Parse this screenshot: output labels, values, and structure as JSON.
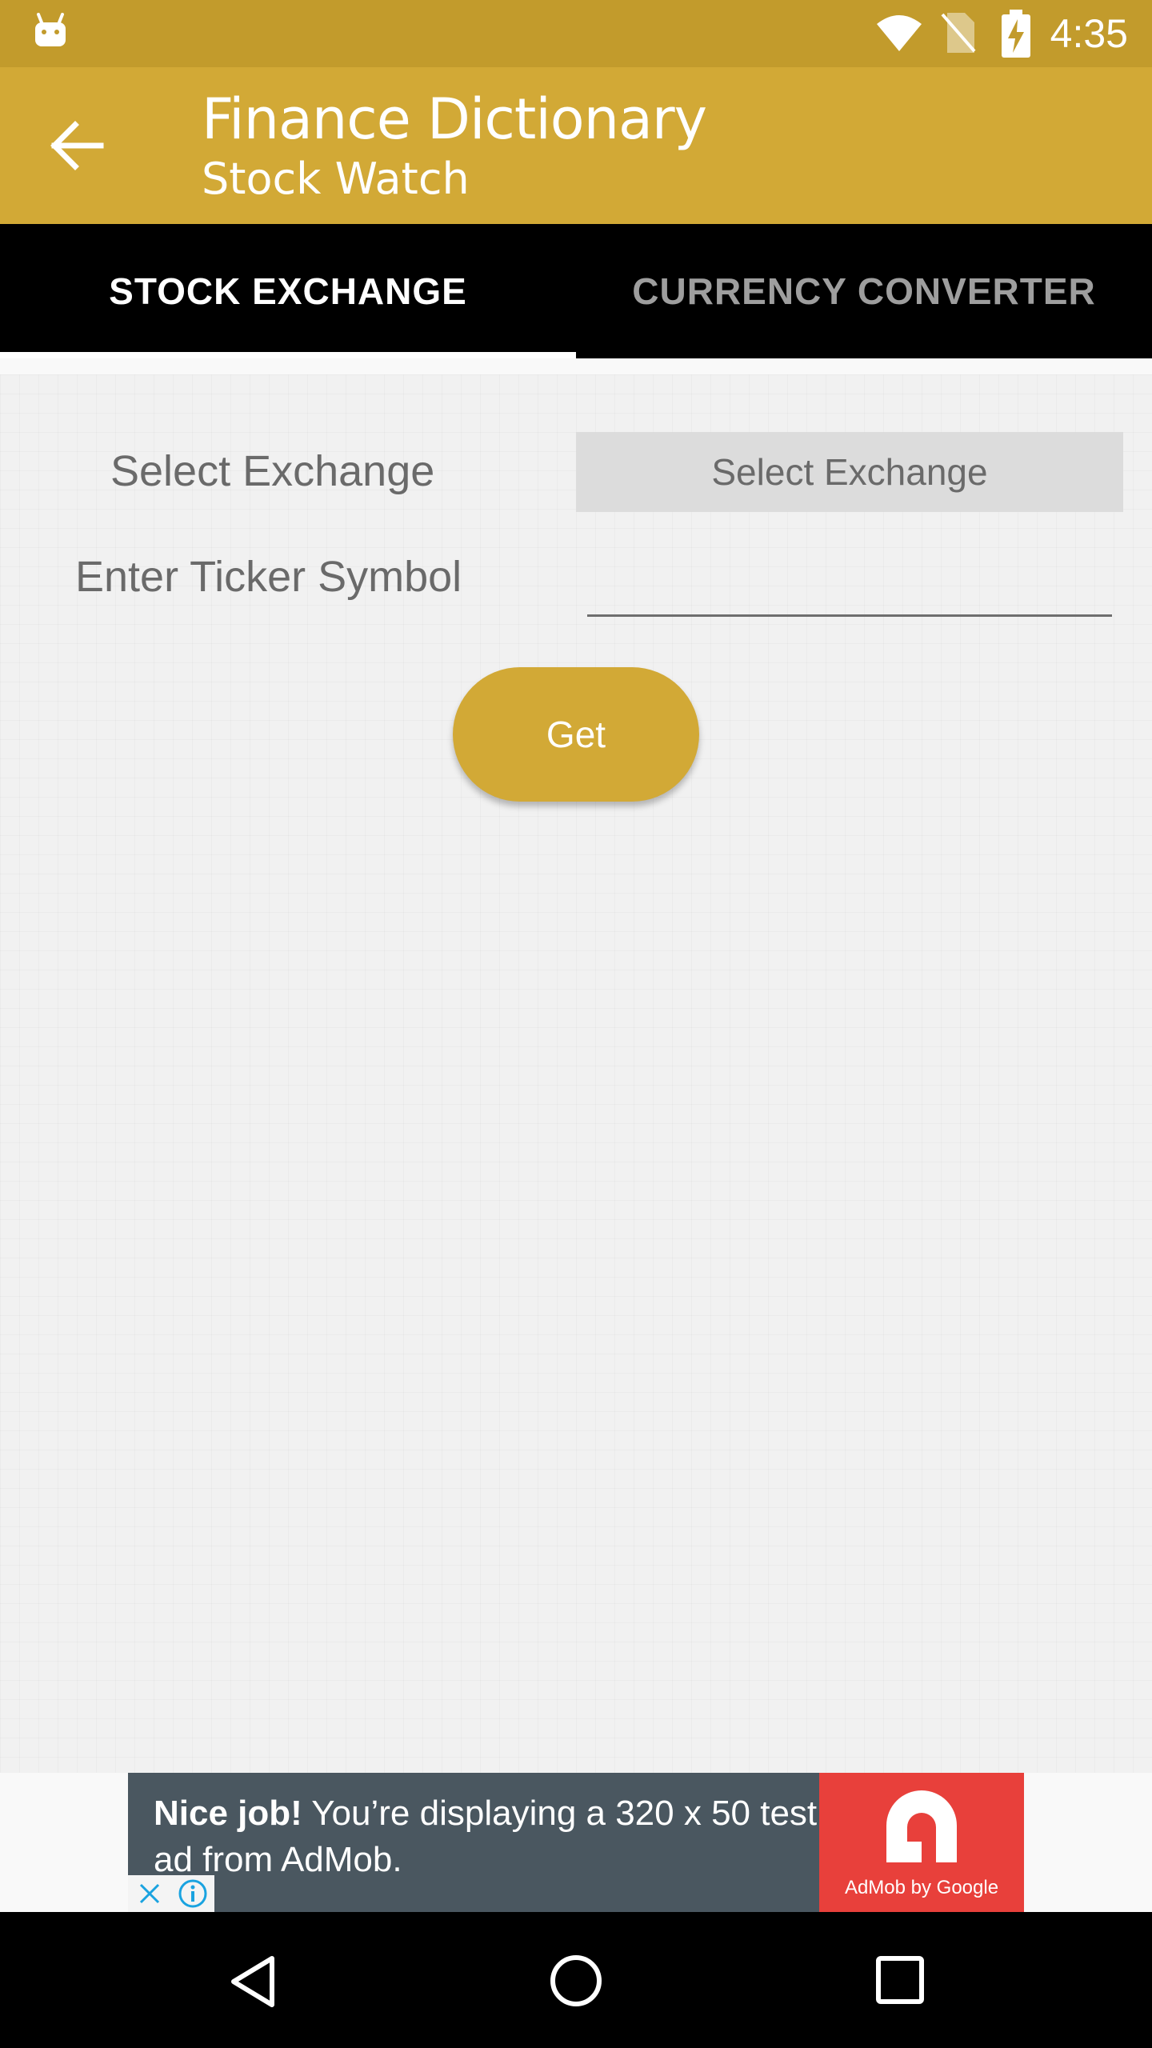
{
  "status_bar": {
    "time": "4:35",
    "icons": [
      "android-icon",
      "wifi-icon",
      "no-sim-icon",
      "battery-charging-icon"
    ]
  },
  "app_bar": {
    "title": "Finance Dictionary",
    "subtitle": "Stock Watch",
    "back_icon": "arrow-left-icon",
    "color": "#d2a936"
  },
  "tabs": [
    {
      "label": "STOCK EXCHANGE",
      "selected": true
    },
    {
      "label": "CURRENCY CONVERTER",
      "selected": false
    }
  ],
  "form": {
    "exchange_label": "Select Exchange",
    "exchange_select_value": "Select Exchange",
    "ticker_label": "Enter Ticker Symbol",
    "ticker_value": "",
    "get_button": "Get"
  },
  "ad": {
    "headline": "Nice job!",
    "body": "You’re displaying a 320 x 50 test ad from AdMob.",
    "brand": "AdMob by Google"
  },
  "nav_bar": {
    "icons": [
      "nav-back-icon",
      "nav-home-icon",
      "nav-recents-icon"
    ]
  }
}
